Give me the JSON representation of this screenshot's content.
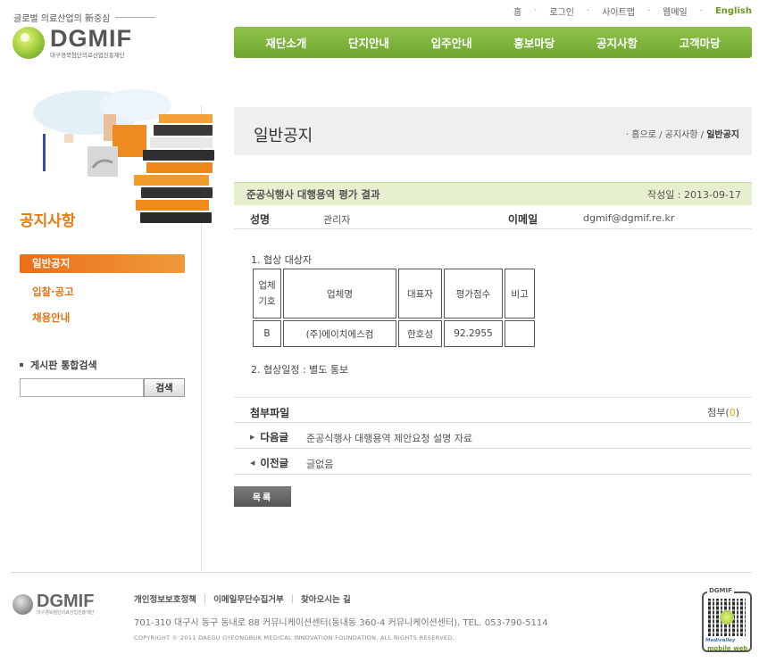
{
  "header": {
    "slogan": "글로벌 의료산업의 新중심",
    "logo_text": "DGMIF",
    "logo_sub": "대구경북첨단의료산업진흥재단",
    "util_links": [
      "홈",
      "로그인",
      "사이트맵",
      "웹메일"
    ],
    "english": "English",
    "gnb": [
      "재단소개",
      "단지안내",
      "입주안내",
      "홍보마당",
      "공지사항",
      "고객마당"
    ]
  },
  "sidebar": {
    "title": "공지사항",
    "menu_active": "일반공지",
    "menu": [
      "입찰·공고",
      "채용안내"
    ],
    "search_label": "게시판 통합검색",
    "search_value": "",
    "search_button": "검색"
  },
  "content": {
    "page_title": "일반공지",
    "breadcrumb": {
      "home": "홈으로",
      "mid": "공지사항",
      "current": "일반공지"
    },
    "subject": "준공식행사 대행용역 평가 결과",
    "date": "작성일 : 2013-09-17",
    "author_label": "성명",
    "author": "관리자",
    "email_label": "이메일",
    "email": "dgmif@dgmif.re.kr",
    "line1": "1. 협상 대상자",
    "table": {
      "headers": [
        "업체\n기호",
        "업체명",
        "대표자",
        "평가점수",
        "비고"
      ],
      "rows": [
        [
          "B",
          "(주)에이치에스컴",
          "한호성",
          "92.2955",
          ""
        ]
      ]
    },
    "line2": "2. 협상일정 : 별도 통보",
    "attach_label": "첨부파일",
    "attach_prefix": "첨부(",
    "attach_count": "0",
    "attach_suffix": ")",
    "next_label": "다음글",
    "next_title": "준공식행사 대행용역 제안요청 설명 자료",
    "prev_label": "이전글",
    "prev_title": "글없음",
    "list_button": "목록"
  },
  "footer": {
    "logo_text": "DGMIF",
    "logo_sub": "대구경북첨단의료산업진흥재단",
    "links": [
      "개인정보보호정책",
      "이메일무단수집거부",
      "찾아오시는 길"
    ],
    "address": "701-310 대구시 동구 동내로 88 커뮤니케이션센터(동내동 360-4 커뮤니케이션센터),  TEL. 053-790-5114",
    "copyright": "COPYRIGHT © 2011 DAEGU GYEONGBUK MEDICAL INNOVATION FOUNDATION. ALL RIGHTS RESERVED.",
    "qr_top": "DGMIF",
    "qr_brand": "Medivalley",
    "qr_mobile": "mobile web"
  },
  "colors": {
    "green": "#7ab33a",
    "orange": "#e87a12",
    "post_head_bg": "#e6f0cf"
  },
  "icons": [
    "logo-ball-icon",
    "bullet-square-icon",
    "arrow-right-icon",
    "arrow-left-icon",
    "qr-code-icon"
  ]
}
